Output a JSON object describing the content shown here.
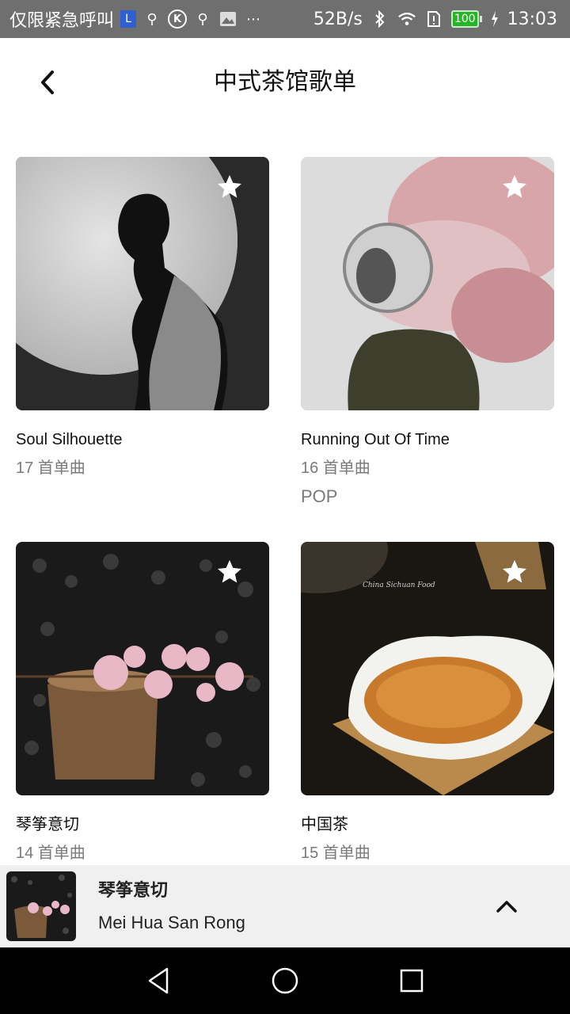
{
  "status_bar": {
    "carrier_text": "仅限紧急呼叫",
    "icons": [
      "l-badge-icon",
      "usb-icon",
      "k-circle-icon",
      "usb-icon",
      "image-icon",
      "more-icon"
    ],
    "net_speed": "52B/s",
    "battery": "100",
    "time": "13:03"
  },
  "header": {
    "title": "中式茶馆歌单"
  },
  "playlists": [
    {
      "title": "Soul Silhouette",
      "count": "17 首单曲",
      "tag": ""
    },
    {
      "title": "Running Out Of Time",
      "count": "16 首单曲",
      "tag": "POP"
    },
    {
      "title": "琴筝意切",
      "count": "14 首单曲",
      "tag": ""
    },
    {
      "title": "中国茶",
      "count": "15 首单曲",
      "tag": ""
    }
  ],
  "cover_caption": "China Sichuan Food",
  "player": {
    "title": "琴筝意切",
    "subtitle": "Mei Hua San Rong"
  },
  "colors": {
    "status_bar": "#6f6f6f",
    "player_bg": "#f0f0f0",
    "nav_bg": "#000000"
  }
}
